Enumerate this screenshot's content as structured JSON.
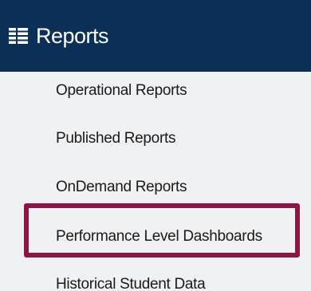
{
  "header": {
    "title": "Reports",
    "icon": "reports-list-icon"
  },
  "menu": {
    "items": [
      {
        "label": "Operational Reports"
      },
      {
        "label": "Published Reports"
      },
      {
        "label": "OnDemand Reports"
      },
      {
        "label": "Performance Level Dashboards",
        "highlighted": true
      },
      {
        "label": "Historical Student Data"
      }
    ]
  },
  "colors": {
    "header_bg": "#0b2f57",
    "menu_bg": "#f0f1f3",
    "highlight_border": "#8a1646"
  }
}
